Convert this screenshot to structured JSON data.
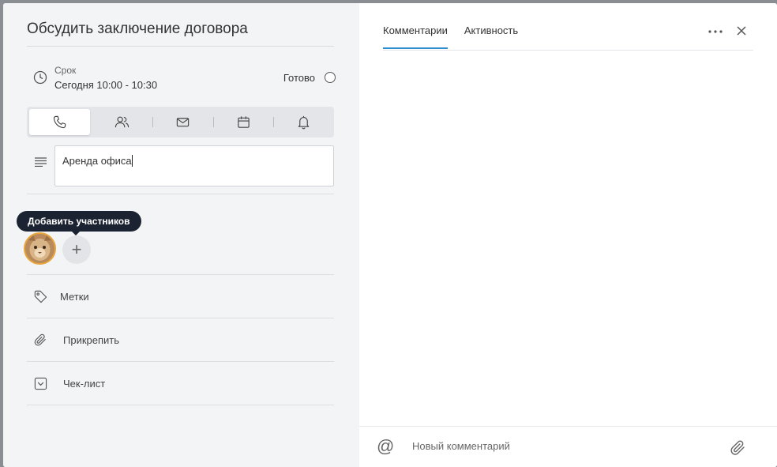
{
  "task": {
    "title": "Обсудить заключение договора",
    "due_label": "Срок",
    "due_value": "Сегодня 10:00 - 10:30",
    "done_label": "Готово",
    "description": "Аренда офиса"
  },
  "types": [
    {
      "name": "phone",
      "icon": "phone-icon",
      "active": true
    },
    {
      "name": "meeting",
      "icon": "people-icon",
      "active": false
    },
    {
      "name": "email",
      "icon": "mail-icon",
      "active": false
    },
    {
      "name": "event",
      "icon": "calendar-icon",
      "active": false
    },
    {
      "name": "reminder",
      "icon": "bell-icon",
      "active": false
    }
  ],
  "members": {
    "tooltip": "Добавить участников",
    "add_symbol": "+"
  },
  "sections": {
    "tags": "Метки",
    "attach": "Прикрепить",
    "checklist": "Чек-лист"
  },
  "tabs": [
    {
      "label": "Комментарии",
      "active": true
    },
    {
      "label": "Активность",
      "active": false
    }
  ],
  "comment": {
    "at_symbol": "@",
    "placeholder": "Новый комментарий"
  },
  "colors": {
    "accent": "#2f8fd0",
    "panel_bg": "#f3f4f6",
    "tooltip_bg": "#1b2333",
    "avatar_ring": "#e8a63a"
  }
}
